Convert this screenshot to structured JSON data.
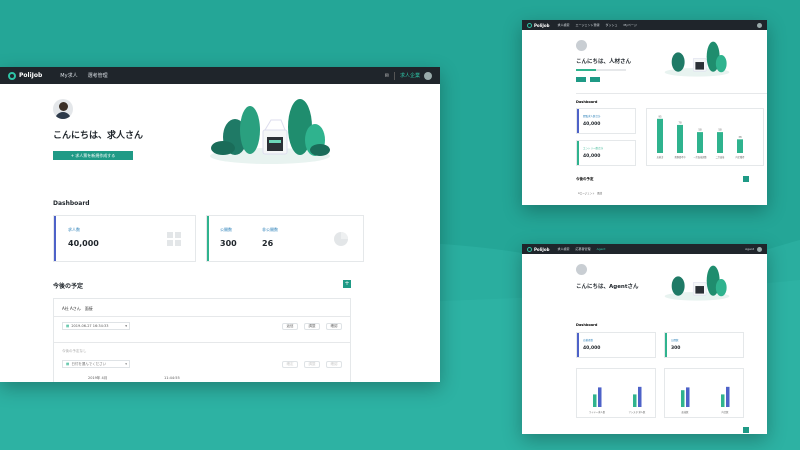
{
  "colors": {
    "bg": "#24a697",
    "nav": "#1f252b",
    "accent": "#1f9a86",
    "blue": "#4e62c8",
    "green": "#2fb38e"
  },
  "main": {
    "logo": "PoliJob",
    "nav": [
      "My求人",
      "選考管理"
    ],
    "user_label": "求人企業",
    "greeting": "こんにちは、求人さん",
    "cta": "+ 求人票を新規作成する",
    "dashboard_title": "Dashboard",
    "card1": {
      "label": "求人数",
      "value": "40,000"
    },
    "card2": {
      "label1": "公開数",
      "value1": "300",
      "label2": "非公開数",
      "value2": "26"
    },
    "schedule_title": "今後の予定",
    "sched1": {
      "name": "A社 Aさん　面接",
      "date": "2019-06-27 16:34:33",
      "btns": [
        "返信",
        "調整",
        "確認"
      ]
    },
    "sched2": {
      "name": "今後の予定なし",
      "select": "日付を選んでください",
      "btns": [
        "確定",
        "調整",
        "確認"
      ]
    },
    "footer_text": "2019年 4月",
    "footer_time": "11:44:55"
  },
  "tr": {
    "logo": "PoliJob",
    "nav": [
      "求人検索",
      "エージェント登録",
      "ダッシュ",
      "Myページ"
    ],
    "greeting": "こんにちは、人材さん",
    "dashboard_title": "Dashboard",
    "card1": {
      "label": "閲覧求人数合計",
      "value": "40,000"
    },
    "card2": {
      "label": "エントリー数合計",
      "value": "40,000"
    },
    "bars": [
      {
        "label": "応募済",
        "value": 95
      },
      {
        "label": "書類選考中",
        "value": 78
      },
      {
        "label": "一次面接調整",
        "value": 58
      },
      {
        "label": "二次面接",
        "value": 58
      },
      {
        "label": "内定獲得",
        "value": 38
      }
    ],
    "schedule_title": "今後の予定",
    "sched_name": "Aエージェント　面談"
  },
  "br": {
    "logo": "PoliJob",
    "nav": [
      "求人検索",
      "応募者管理",
      "Agent"
    ],
    "user_label": "Agent",
    "greeting": "こんにちは、Agentさん",
    "dashboard_title": "Dashboard",
    "card1": {
      "label": "応募者数",
      "value": "40,000"
    },
    "card2": {
      "label": "公開数",
      "value": "300"
    },
    "groups": [
      {
        "label": "ワイヤー求人数",
        "green": 45,
        "blue": 70
      },
      {
        "label": "アシスタ 求人数",
        "green": 45,
        "blue": 72
      },
      {
        "label": "面接数",
        "green": 60,
        "blue": 70
      },
      {
        "label": "内定数",
        "green": 45,
        "blue": 72
      }
    ]
  }
}
